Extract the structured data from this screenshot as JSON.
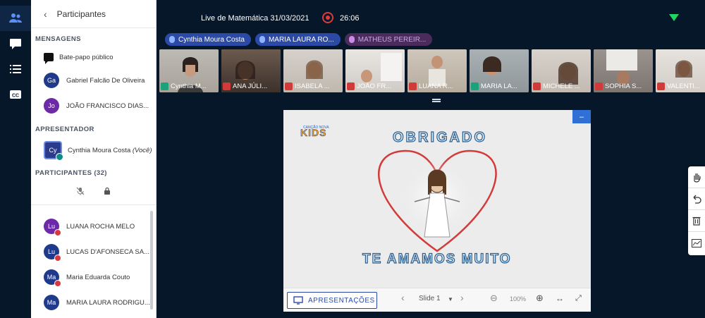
{
  "nav": {
    "items": [
      {
        "name": "users-icon"
      },
      {
        "name": "chat-icon"
      },
      {
        "name": "list-icon"
      },
      {
        "name": "closed-caption-icon"
      }
    ]
  },
  "panel": {
    "header": "Participantes",
    "messages_title": "MENSAGENS",
    "public_chat": "Bate-papo público",
    "message_users": [
      {
        "initials": "Ga",
        "name": "Gabriel Falcão De Oliveira"
      },
      {
        "initials": "Jo",
        "name": "JOÃO FRANCISCO DIAS..."
      }
    ],
    "presenter_title": "APRESENTADOR",
    "presenter": {
      "initials": "Cy",
      "name": "Cynthia Moura Costa",
      "suffix": "(Você)"
    },
    "participants_title": "PARTICIPANTES (32)",
    "participants": [
      {
        "initials": "Lu",
        "name": "LUANA ROCHA MELO"
      },
      {
        "initials": "Lu",
        "name": "LUCAS D'AFONSECA SA..."
      },
      {
        "initials": "Ma",
        "name": "Maria Eduarda Couto"
      },
      {
        "initials": "Ma",
        "name": "MARIA LAURA RODRIGU..."
      }
    ]
  },
  "topbar": {
    "title": "Live de Matemática 31/03/2021",
    "timer": "26:06"
  },
  "talking": [
    {
      "name": "Cynthia Moura Costa",
      "state": "active"
    },
    {
      "name": "MARIA LAURA RO...",
      "state": "active"
    },
    {
      "name": "MATHEUS PEREIR...",
      "state": "dim"
    }
  ],
  "videos": [
    {
      "label": "Cynthia M...",
      "mic": "on"
    },
    {
      "label": "ANA JÚLI...",
      "mic": "off"
    },
    {
      "label": "ISABELA ...",
      "mic": "off"
    },
    {
      "label": "JOÃO FR...",
      "mic": "off"
    },
    {
      "label": "LUANA R...",
      "mic": "off"
    },
    {
      "label": "MARIA LA...",
      "mic": "on"
    },
    {
      "label": "MICHELE ...",
      "mic": "off"
    },
    {
      "label": "SOPHIA S...",
      "mic": "off"
    },
    {
      "label": "VALENTI...",
      "mic": "off"
    }
  ],
  "slide": {
    "logo_top": "CANÇÃO NOVA",
    "logo": "KIDS",
    "heading": "OBRIGADO",
    "footer_text": "TE AMAMOS MUITO"
  },
  "toolbar": {
    "apresentacoes": "APRESENTAÇÕES",
    "slide": "Slide 1",
    "zoom": "100%"
  },
  "colors": {
    "background": "#06172a",
    "accent": "#2b4aa6",
    "recording": "#e03a3a"
  }
}
